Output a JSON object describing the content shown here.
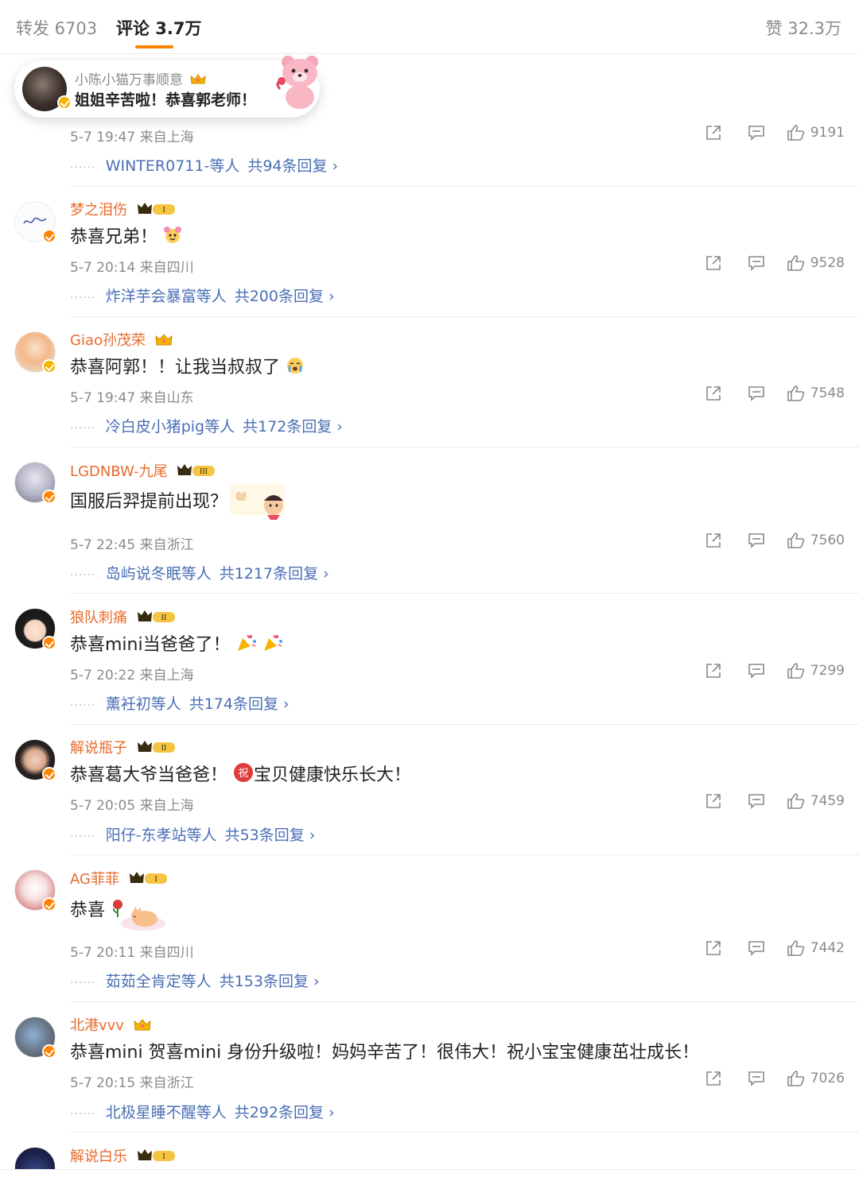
{
  "tabs": {
    "repost": "转发 6703",
    "comments": "评论 3.7万",
    "likes": "赞 32.3万"
  },
  "featured": {
    "username": "小陈小猫万事顺意",
    "text": "姐姐辛苦啦！恭喜郭老师！"
  },
  "colors": {
    "accent": "#ff8200",
    "username": "#e86b2c",
    "link": "#4a6fb5",
    "muted": "#8a8a8a"
  },
  "comments": [
    {
      "username": "",
      "text": "",
      "time": "5-7 19:47 来自上海",
      "likes": "9191",
      "reply_users": "WINTER0711-等人",
      "reply_total": "共94条回复"
    },
    {
      "username": "梦之泪伤",
      "level": "I",
      "text": "恭喜兄弟！",
      "time": "5-7 20:14 来自四川",
      "likes": "9528",
      "reply_users": "炸洋芋会暴富等人",
      "reply_total": "共200条回复"
    },
    {
      "username": "Giao孙茂荣",
      "text": "恭喜阿郭！！让我当叔叔了",
      "time": "5-7 19:47 来自山东",
      "likes": "7548",
      "reply_users": "冷白皮小猪pig等人",
      "reply_total": "共172条回复"
    },
    {
      "username": "LGDNBW-九尾",
      "level": "III",
      "text": "国服后羿提前出现？",
      "time": "5-7 22:45 来自浙江",
      "likes": "7560",
      "reply_users": "岛屿说冬眠等人",
      "reply_total": "共1217条回复"
    },
    {
      "username": "狼队刺痛",
      "level": "II",
      "text": "恭喜mini当爸爸了！",
      "time": "5-7 20:22 来自上海",
      "likes": "7299",
      "reply_users": "薰衽初等人",
      "reply_total": "共174条回复"
    },
    {
      "username": "解说瓶子",
      "level": "II",
      "text": "恭喜葛大爷当爸爸！",
      "text2": "宝贝健康快乐长大！",
      "time": "5-7 20:05 来自上海",
      "likes": "7459",
      "reply_users": "阳仔-东孝站等人",
      "reply_total": "共53条回复"
    },
    {
      "username": "AG菲菲",
      "level": "I",
      "text": "恭喜",
      "time": "5-7 20:11 来自四川",
      "likes": "7442",
      "reply_users": "茹茹全肯定等人",
      "reply_total": "共153条回复"
    },
    {
      "username": "北港vvv",
      "text": "恭喜mini 贺喜mini 身份升级啦！妈妈辛苦了！很伟大！祝小宝宝健康茁壮成长！",
      "time": "5-7 20:15 来自浙江",
      "likes": "7026",
      "reply_users": "北极星睡不醒等人",
      "reply_total": "共292条回复"
    },
    {
      "username": "解说白乐",
      "level": "I"
    }
  ],
  "icons": {
    "share": "share-icon",
    "comment": "comment-icon",
    "like": "thumbs-up-icon",
    "verified": "verified-badge-icon",
    "crown": "crown-level-icon",
    "chevron": "chevron-right-icon"
  }
}
